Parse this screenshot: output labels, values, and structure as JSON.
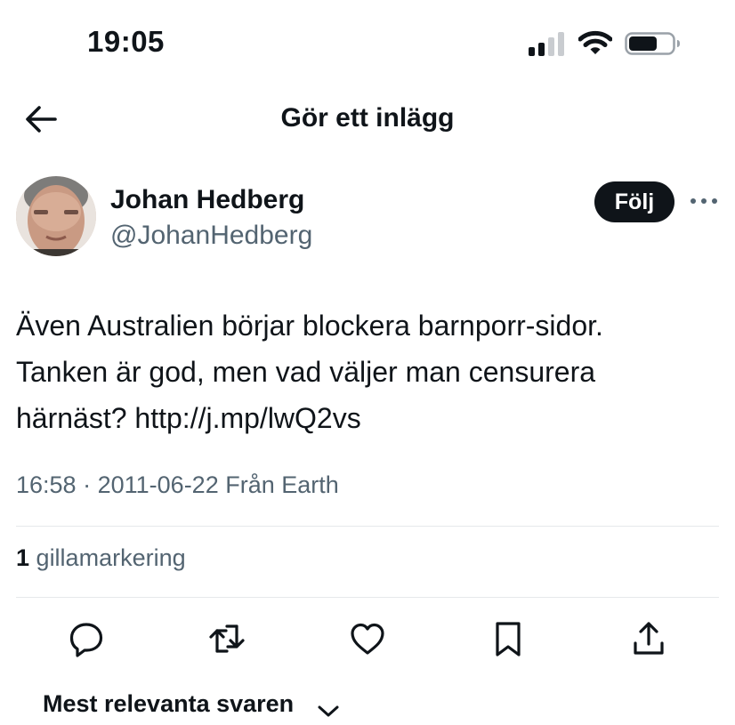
{
  "status_bar": {
    "time": "19:05",
    "signal_icon": "cellular-signal-icon",
    "wifi_icon": "wifi-icon",
    "battery_icon": "battery-icon"
  },
  "header": {
    "title": "Gör ett inlägg",
    "back_icon": "arrow-left-icon"
  },
  "author": {
    "name": "Johan Hedberg",
    "handle": "@JohanHedberg",
    "follow_label": "Följ",
    "more_icon": "more-horizontal-icon"
  },
  "tweet": {
    "text_line_1": "Även Australien börjar blockera barnporr-sidor.",
    "text_line_2": "Tanken är god, men vad väljer man censurera",
    "text_line_3_prefix": "härnäst?",
    "link": "http://j.mp/lwQ2vs",
    "time": "16:58",
    "separator": "·",
    "date": "2011-06-22",
    "source": "Från Earth"
  },
  "stats": {
    "likes_count": "1",
    "likes_label": "gillamarkering"
  },
  "actions": [
    {
      "name": "reply",
      "icon": "reply-bubble-icon"
    },
    {
      "name": "repost",
      "icon": "repost-arrows-icon"
    },
    {
      "name": "like",
      "icon": "heart-icon"
    },
    {
      "name": "bookmark",
      "icon": "bookmark-icon"
    },
    {
      "name": "share",
      "icon": "share-upload-icon"
    }
  ],
  "replies": {
    "sort_label": "Mest relevanta svaren",
    "chevron_icon": "chevron-down-icon"
  },
  "colors": {
    "text_primary": "#0f1419",
    "text_secondary": "#536471",
    "divider": "#e6e9eb",
    "follow_bg": "#0f1419",
    "follow_text": "#ffffff"
  }
}
